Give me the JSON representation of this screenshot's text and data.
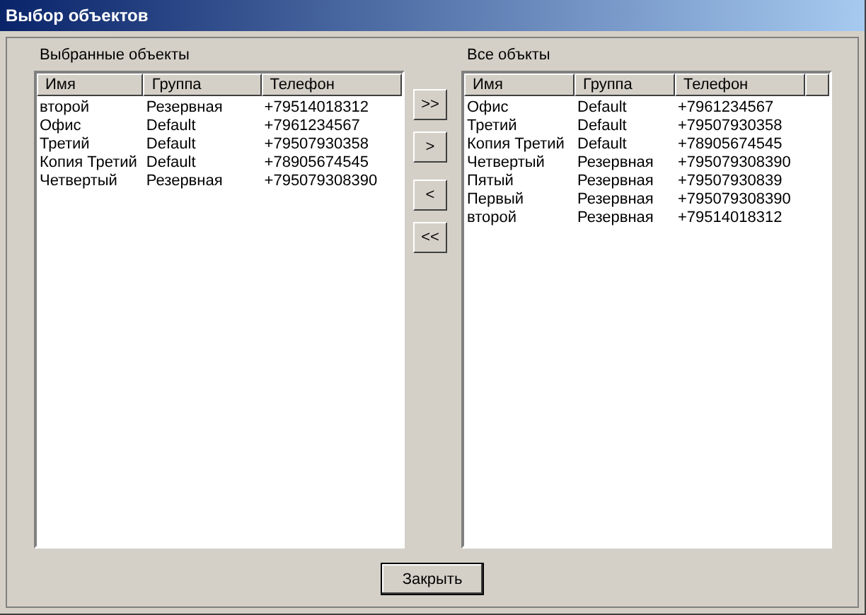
{
  "window": {
    "title": "Выбор объектов"
  },
  "selected_list": {
    "label": "Выбранные объекты",
    "columns": [
      "Имя",
      "Группа",
      "Телефон"
    ],
    "rows": [
      [
        "второй",
        "Резервная",
        "+79514018312"
      ],
      [
        "Офис",
        "Default",
        "+7961234567"
      ],
      [
        "Третий",
        "Default",
        "+79507930358"
      ],
      [
        "Копия Третий",
        "Default",
        "+78905674545"
      ],
      [
        "Четвертый",
        "Резервная",
        "+795079308390"
      ]
    ]
  },
  "move_buttons": [
    ">>",
    ">",
    "<",
    "<<"
  ],
  "all_list": {
    "label": "Все объкты",
    "columns": [
      "Имя",
      "Группа",
      "Телефон"
    ],
    "rows": [
      [
        "Офис",
        "Default",
        "+7961234567"
      ],
      [
        "Третий",
        "Default",
        "+79507930358"
      ],
      [
        "Копия Третий",
        "Default",
        "+78905674545"
      ],
      [
        "Четвертый",
        "Резервная",
        "+795079308390"
      ],
      [
        "Пятый",
        "Резервная",
        "+79507930839"
      ],
      [
        "Первый",
        "Резервная",
        "+795079308390"
      ],
      [
        "второй",
        "Резервная",
        "+79514018312"
      ]
    ]
  },
  "close_button": "Закрыть"
}
